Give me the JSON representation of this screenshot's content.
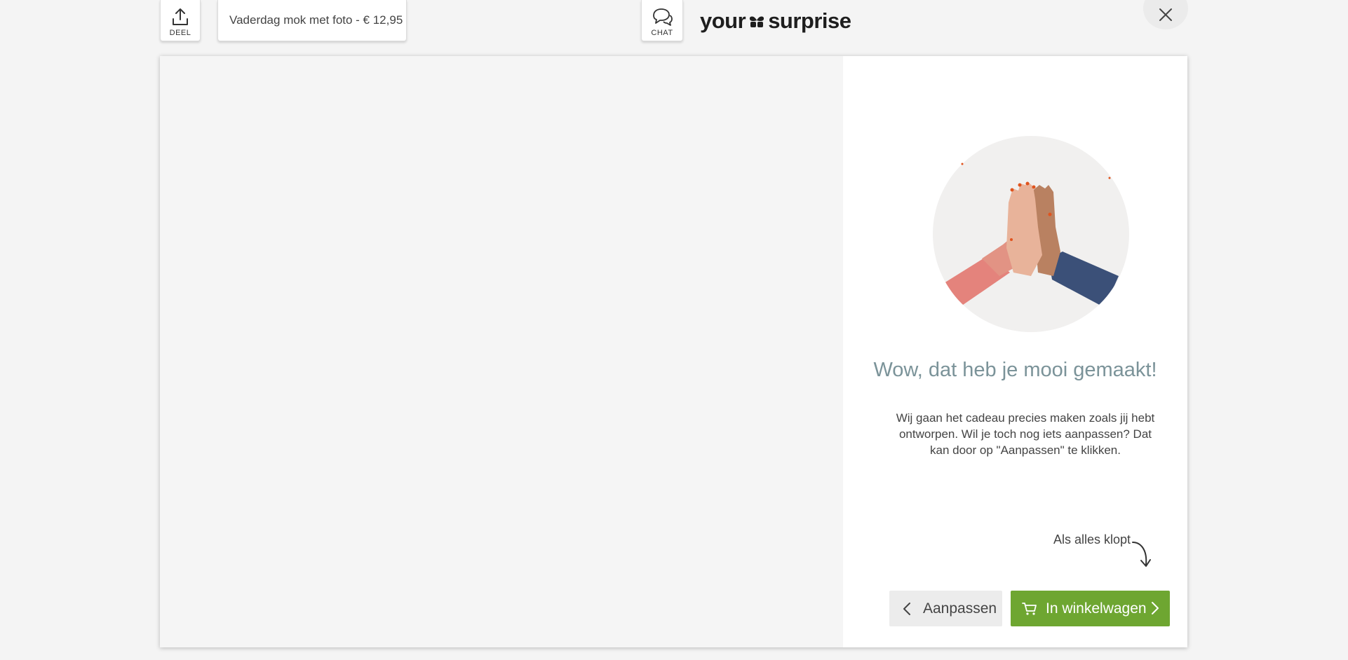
{
  "header": {
    "share_label": "DEEL",
    "product_title": "Vaderdag mok met foto - € 12,95",
    "chat_label": "CHAT",
    "logo": {
      "left": "your",
      "right": "surprise"
    }
  },
  "confirmation": {
    "heading": "Wow, dat heb je mooi gemaakt!",
    "body": "Wij gaan het cadeau precies maken zoals jij hebt ontworpen. Wil je toch nog iets aanpassen? Dat kan door op \"Aanpassen\" te klikken.",
    "hint": "Als alles klopt",
    "back_label": "Aanpassen",
    "cart_label": "In winkelwagen"
  },
  "colors": {
    "primary_green": "#6ea631",
    "heading_teal": "#7b9399",
    "background": "#f4f4f4"
  },
  "icons": [
    "upload-icon",
    "chat-bubbles-icon",
    "heart-clover-icon",
    "close-icon",
    "chevron-left-icon",
    "cart-icon",
    "chevron-right-icon",
    "curved-arrow-icon"
  ]
}
